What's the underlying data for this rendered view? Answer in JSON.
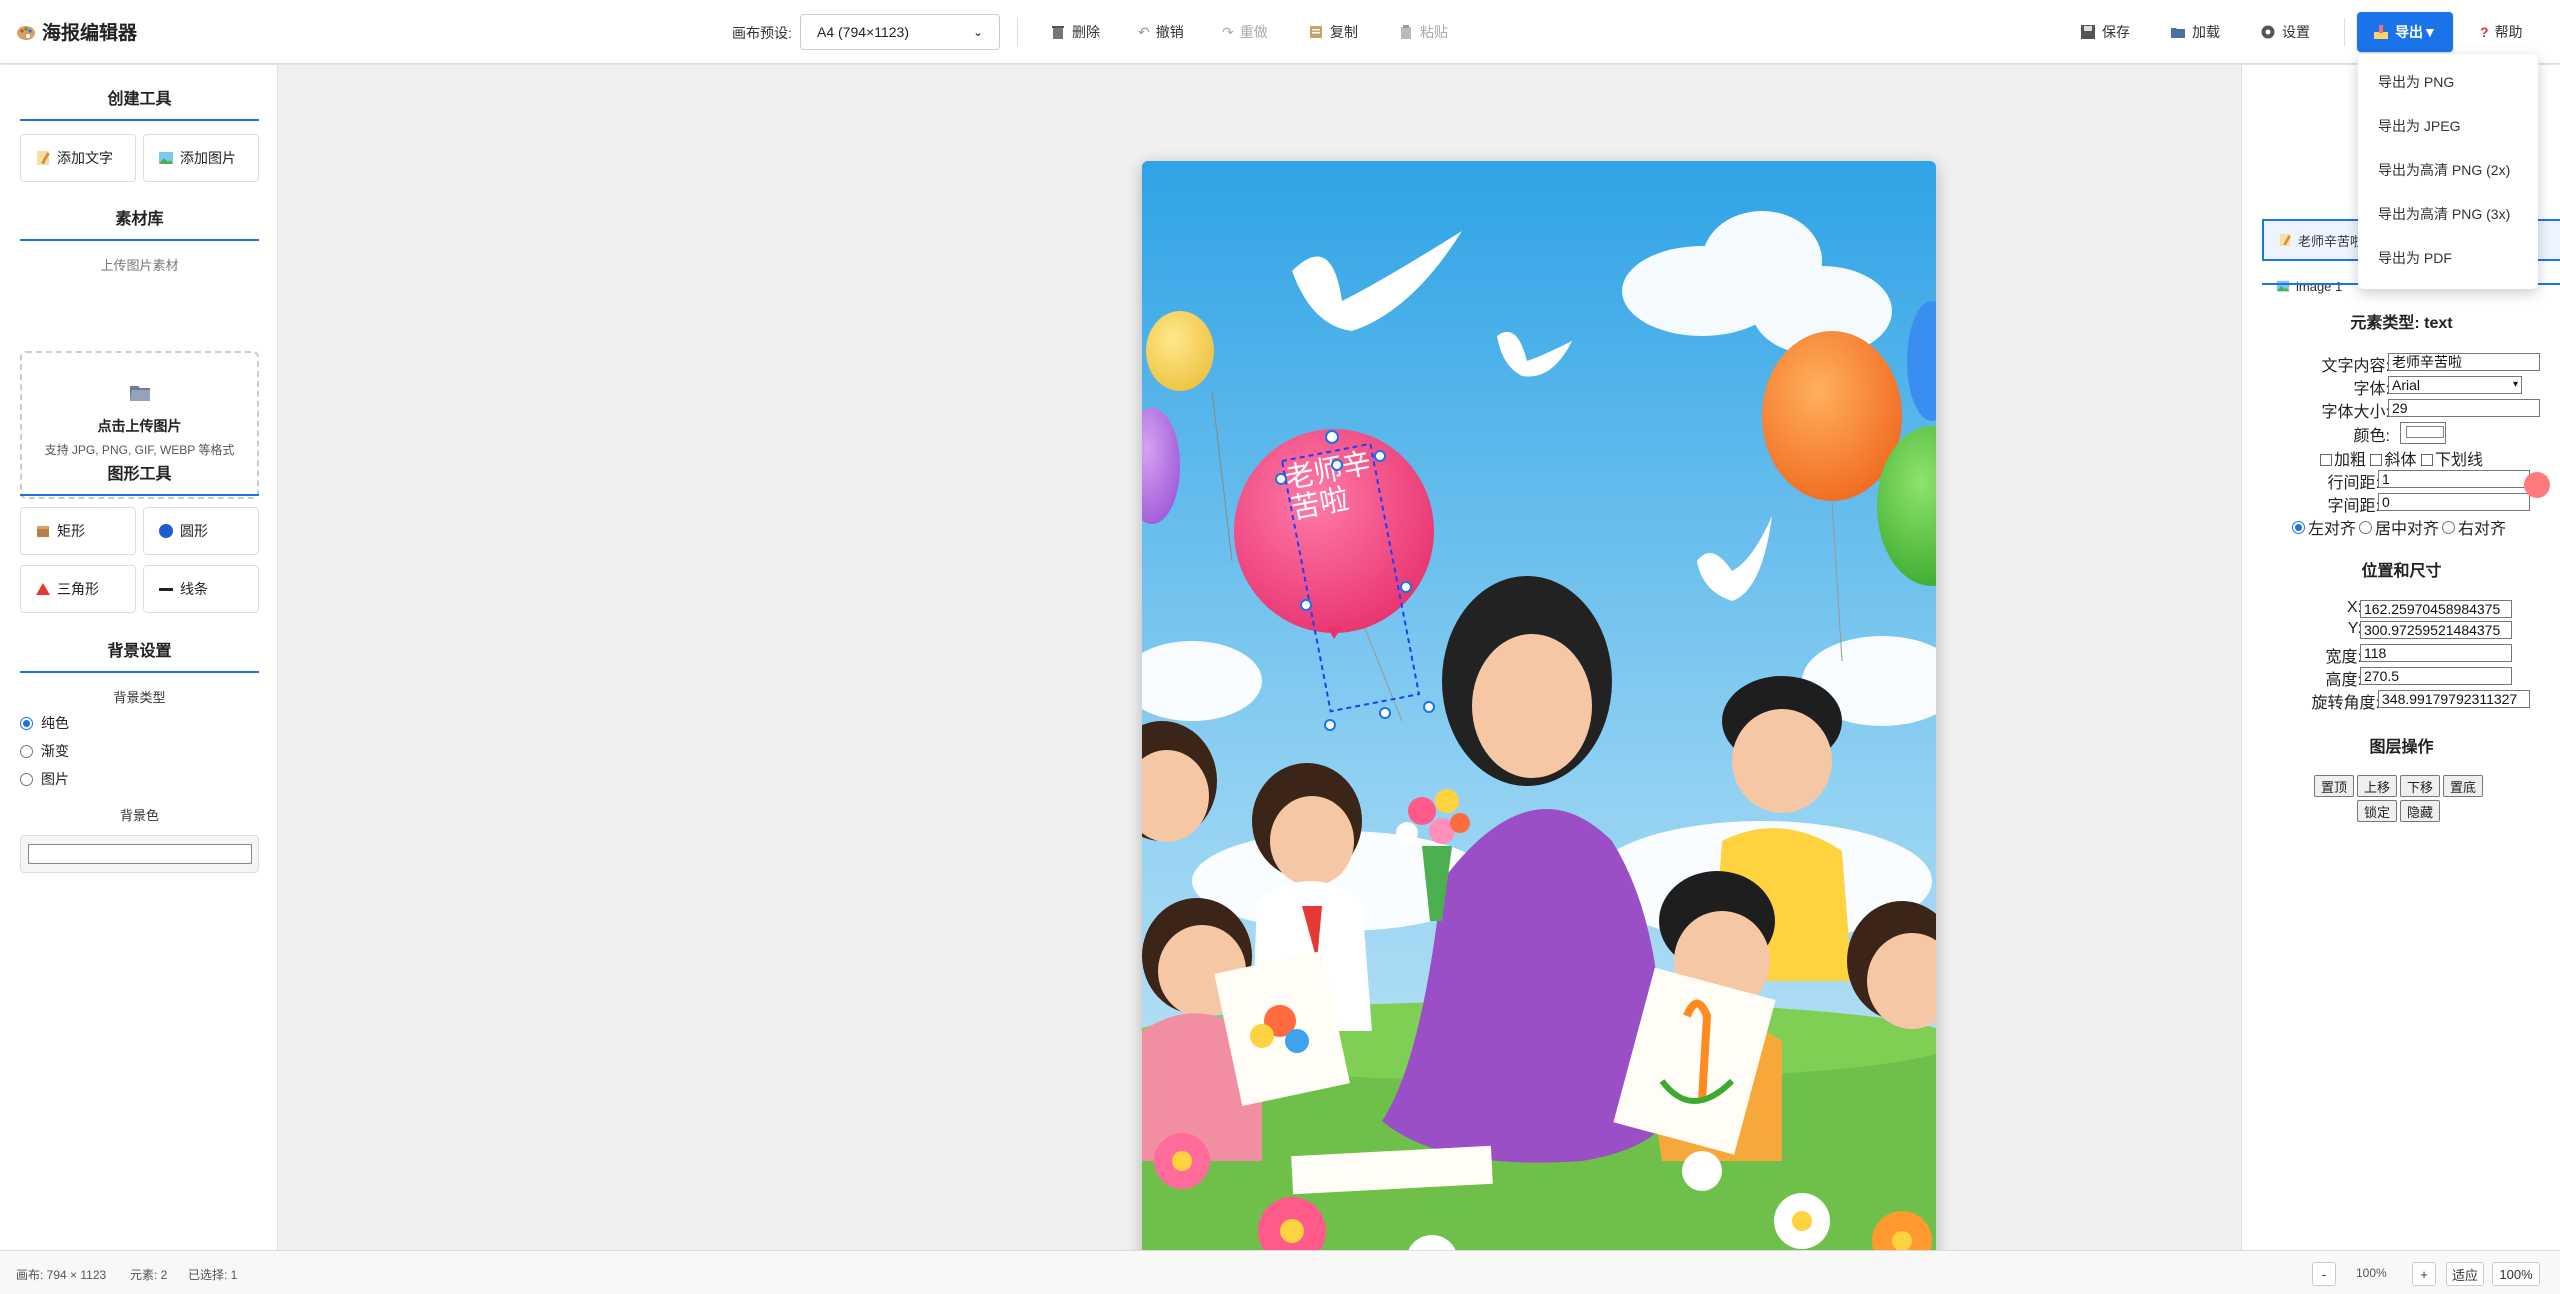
{
  "app": {
    "title": "海报编辑器"
  },
  "toolbar": {
    "preset_label": "画布预设:",
    "preset_value": "A4 (794×1123)",
    "delete": "删除",
    "undo": "撤销",
    "redo": "重做",
    "copy": "复制",
    "paste": "粘贴",
    "save": "保存",
    "load": "加载",
    "settings": "设置",
    "export": "导出▼",
    "help": "帮助"
  },
  "left": {
    "create_title": "创建工具",
    "add_text": "添加文字",
    "add_image": "添加图片",
    "library_title": "素材库",
    "upload_sub": "上传图片素材",
    "upload_title": "点击上传图片",
    "upload_hint": "支持 JPG, PNG, GIF, WEBP 等格式",
    "shape_title": "图形工具",
    "rect": "矩形",
    "circle": "圆形",
    "triangle": "三角形",
    "line": "线条",
    "bg_title": "背景设置",
    "bg_type_label": "背景类型",
    "bg_solid": "纯色",
    "bg_gradient": "渐变",
    "bg_image": "图片",
    "bg_color_label": "背景色",
    "bg_type_selected": "纯色"
  },
  "canvas": {
    "text_element": "老师辛苦啦",
    "background": "#5bb8e8"
  },
  "right": {
    "layers": [
      {
        "label": "老师辛苦啦",
        "selected": true,
        "icon": "text-icon"
      },
      {
        "label": "image 1",
        "selected": false,
        "icon": "image-icon"
      }
    ],
    "element_type": "元素类型: text",
    "text_content_label": "文字内容:",
    "text_content": "老师辛苦啦",
    "font_label": "字体:",
    "font_value": "Arial",
    "font_size_label": "字体大小:",
    "font_size": "29",
    "color_label": "颜色:",
    "bold": "加粗",
    "italic": "斜体",
    "underline": "下划线",
    "line_height_label": "行间距:",
    "line_height": "1",
    "letter_spacing_label": "字间距:",
    "letter_spacing": "0",
    "align_left": "左对齐",
    "align_center": "居中对齐",
    "align_right": "右对齐",
    "pos_title": "位置和尺寸",
    "x_label": "X:",
    "x": "162.25970458984375",
    "y_label": "Y:",
    "y": "300.97259521484375",
    "w_label": "宽度:",
    "w": "118",
    "h_label": "高度:",
    "h": "270.5",
    "rot_label": "旋转角度:",
    "rot": "348.99179792311327",
    "layer_ops_title": "图层操作",
    "to_top": "置顶",
    "up": "上移",
    "down": "下移",
    "to_bottom": "置底",
    "lock": "锁定",
    "hide": "隐藏"
  },
  "export_menu": {
    "items": [
      "导出为 PNG",
      "导出为 JPEG",
      "导出为高清 PNG (2x)",
      "导出为高清 PNG (3x)",
      "导出为 PDF"
    ]
  },
  "status": {
    "canvas_size": "画布: 794 × 1123",
    "elements": "元素: 2",
    "selected": "已选择: 1",
    "zoom_out": "-",
    "zoom_value": "100%",
    "zoom_in": "+",
    "fit": "适应",
    "zoom_100": "100%"
  },
  "colors": {
    "accent": "#1a73e8"
  }
}
